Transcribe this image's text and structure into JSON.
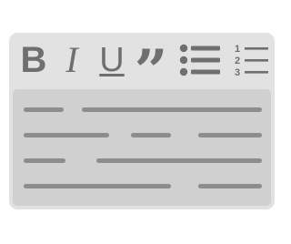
{
  "toolbar": {
    "bold_label": "B",
    "italic_label": "I",
    "underline_label": "U",
    "quote_label": "”",
    "numbered_digits": [
      "1",
      "2",
      "3"
    ]
  },
  "icons": {
    "bold": "bold-icon",
    "italic": "italic-icon",
    "underline": "underline-icon",
    "quote": "quote-icon",
    "bulleted_list": "bulleted-list-icon",
    "numbered_list": "numbered-list-icon"
  },
  "colors": {
    "card_background": "#e2e2e2",
    "editor_background": "#d0d0d0",
    "icon": "#6f6f6f",
    "text_placeholder": "#8d8d8d"
  }
}
